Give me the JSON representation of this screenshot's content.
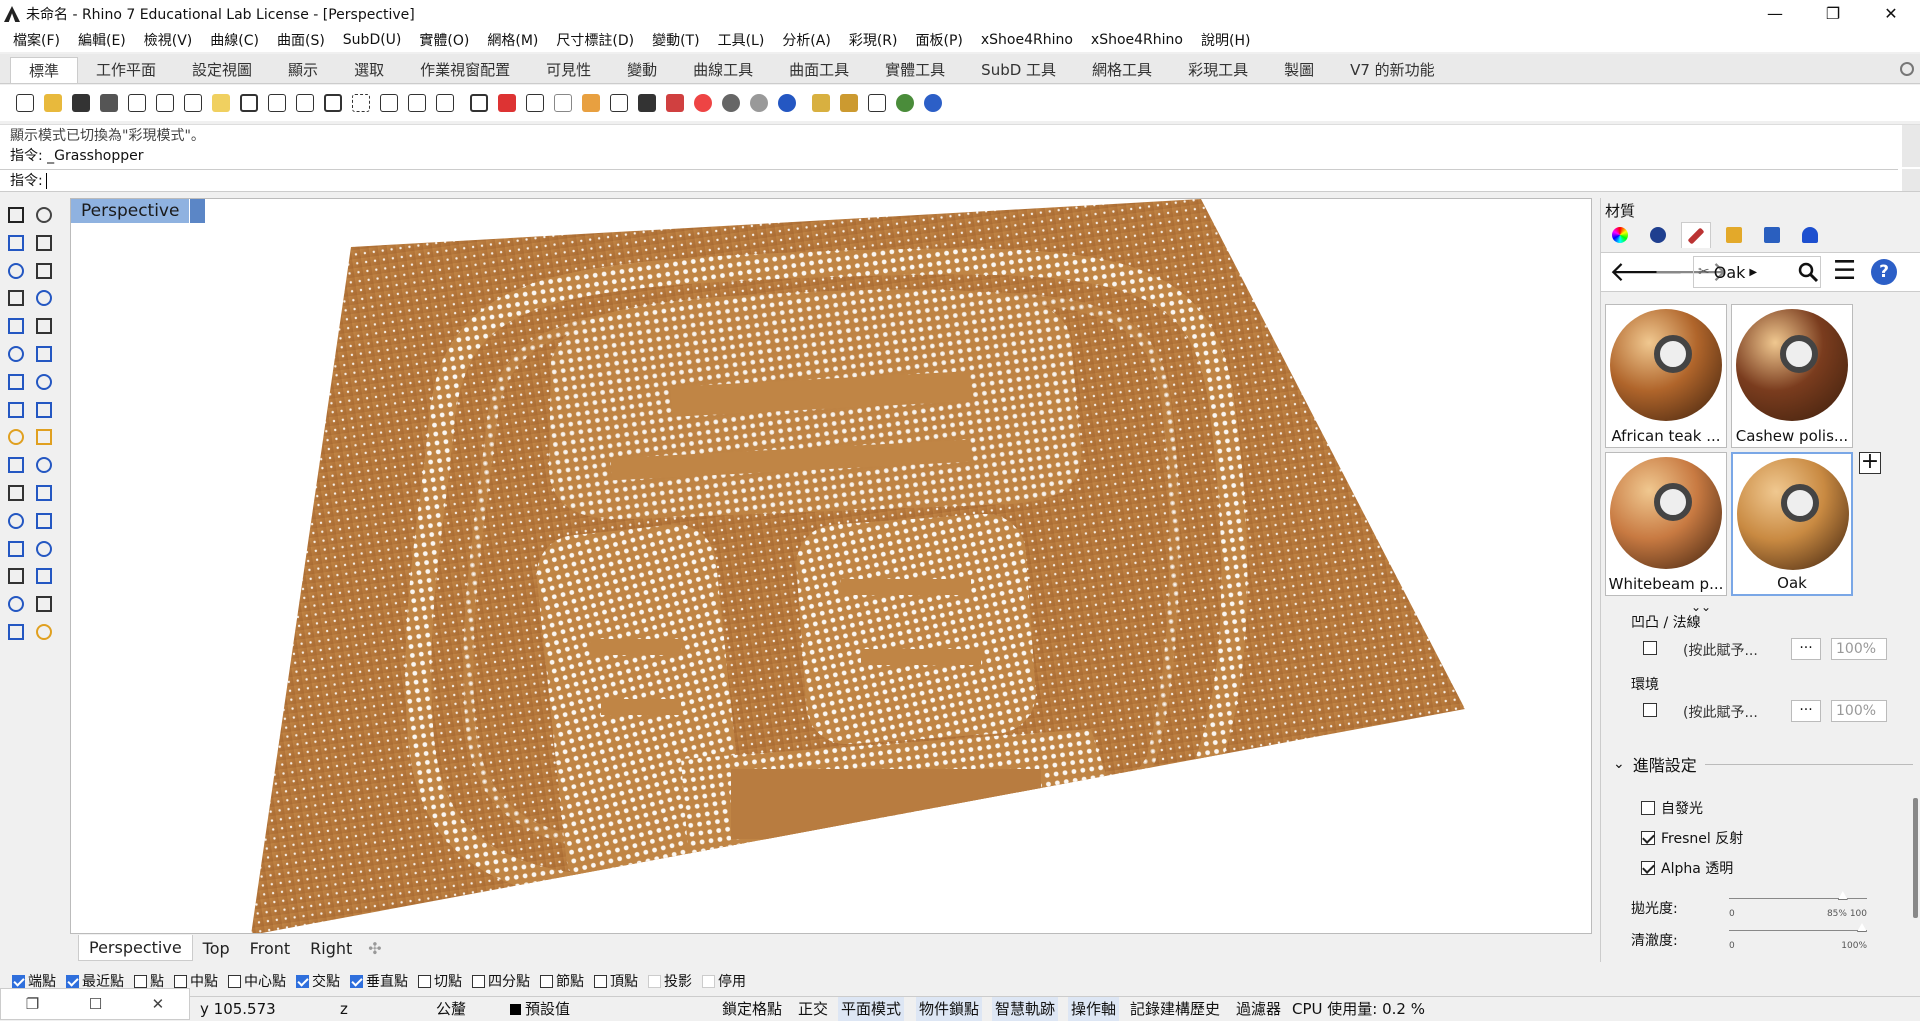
{
  "window": {
    "title": "未命名 - Rhino 7 Educational Lab License - [Perspective]",
    "minimize": "—",
    "maximize": "❐",
    "close": "✕"
  },
  "menu": [
    "檔案(F)",
    "編輯(E)",
    "檢視(V)",
    "曲線(C)",
    "曲面(S)",
    "SubD(U)",
    "實體(O)",
    "網格(M)",
    "尺寸標註(D)",
    "變動(T)",
    "工具(L)",
    "分析(A)",
    "彩現(R)",
    "面板(P)",
    "xShoe4Rhino",
    "xShoe4Rhino",
    "說明(H)"
  ],
  "tabs": [
    "標準",
    "工作平面",
    "設定視圖",
    "顯示",
    "選取",
    "作業視窗配置",
    "可見性",
    "變動",
    "曲線工具",
    "曲面工具",
    "實體工具",
    "SubD 工具",
    "網格工具",
    "彩現工具",
    "製圖",
    "V7 的新功能"
  ],
  "command": {
    "history1": "顯示模式已切換為\"彩現模式\"。",
    "history2": "指令: _Grasshopper",
    "prompt": "指令:"
  },
  "viewport": {
    "active": "Perspective",
    "tabs": [
      "Perspective",
      "Top",
      "Front",
      "Right"
    ]
  },
  "panel": {
    "title": "材質",
    "crumb": "Oak",
    "materials": [
      {
        "name": "African teak ...",
        "color": "#b0652b"
      },
      {
        "name": "Cashew polis...",
        "color": "#7a3c1e"
      },
      {
        "name": "Whitebeam p...",
        "color": "#c87a42"
      },
      {
        "name": "Oak",
        "color": "#c98a42"
      }
    ],
    "bump_label": "凹凸 / 法線",
    "bump_value": "(按此賦予...",
    "env_label": "環境",
    "env_value": "(按此賦予...",
    "dots": "···",
    "percent": "100%",
    "advanced": "進階設定",
    "self_illum": "自發光",
    "fresnel": "Fresnel 反射",
    "alpha": "Alpha 透明",
    "gloss_label": "拋光度:",
    "gloss_min": "0",
    "gloss_max": "85% 100",
    "clarity_label": "清澈度:",
    "clarity_min": "0",
    "clarity_max": "100%",
    "gloss_level": 0.85,
    "clarity_level": 1.0
  },
  "osnaps": [
    {
      "label": "端點",
      "on": true
    },
    {
      "label": "最近點",
      "on": true
    },
    {
      "label": "點",
      "on": false
    },
    {
      "label": "中點",
      "on": false
    },
    {
      "label": "中心點",
      "on": false
    },
    {
      "label": "交點",
      "on": true
    },
    {
      "label": "垂直點",
      "on": true
    },
    {
      "label": "切點",
      "on": false
    },
    {
      "label": "四分點",
      "on": false
    },
    {
      "label": "節點",
      "on": false
    },
    {
      "label": "頂點",
      "on": false
    },
    {
      "label": "投影",
      "on": false
    },
    {
      "label": "停用",
      "on": false
    }
  ],
  "status": {
    "y": "y 105.573",
    "z": "z",
    "unit": "公釐",
    "layer": "預設值",
    "grid_snap": "鎖定格點",
    "ortho": "正交",
    "planar": "平面模式",
    "osnap": "物件鎖點",
    "smarttrack": "智慧軌跡",
    "gumball": "操作軸",
    "history": "記錄建構歷史",
    "filter": "過濾器",
    "cpu": "CPU 使用量: 0.2 %"
  },
  "colors": {
    "wood": "#b5773a",
    "accent": "#2f6fdc",
    "viewport_label": "#8fb2e0"
  }
}
